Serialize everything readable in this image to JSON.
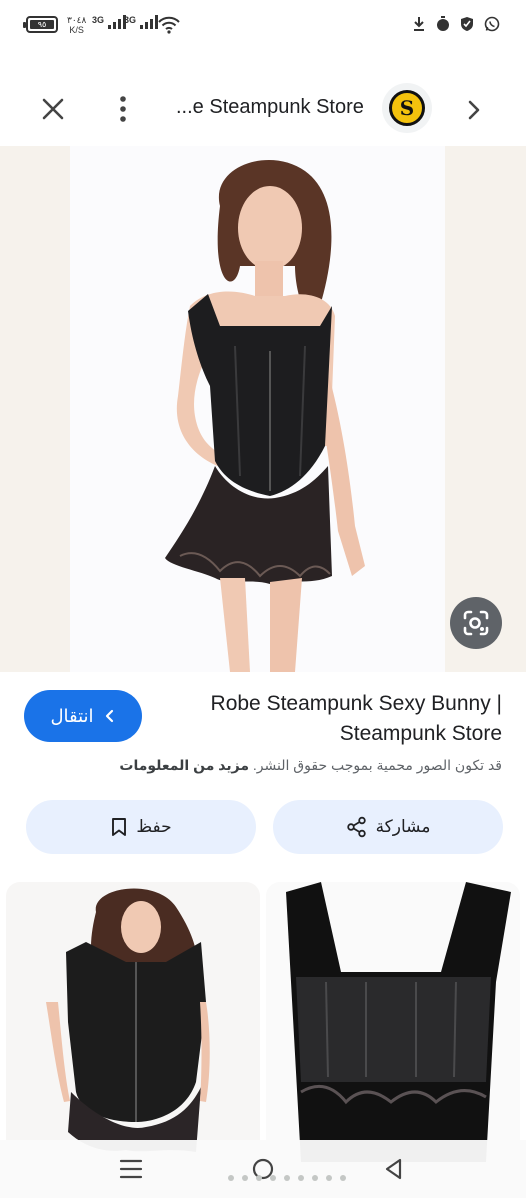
{
  "status_bar": {
    "battery": "٩٥",
    "net_speed_value": "٣٠٤٨",
    "net_speed_unit": "K/S",
    "signal_1": "3G",
    "signal_2": "3G"
  },
  "top_bar": {
    "source_title": "...e Steampunk Store",
    "source_logo_letter": "S"
  },
  "result": {
    "visit_label": "انتقال",
    "title": "Robe Steampunk Sexy Bunny | Steampunk Store",
    "copyright_text": "قد تكون الصور محمية بموجب حقوق النشر.",
    "more_info_label": "مزيد من المعلومات"
  },
  "actions": {
    "share_label": "مشاركة",
    "save_label": "حفظ"
  },
  "colors": {
    "primary": "#1a73e8",
    "chip_bg": "#e8f0fe",
    "lens_bg": "#5f6368"
  }
}
